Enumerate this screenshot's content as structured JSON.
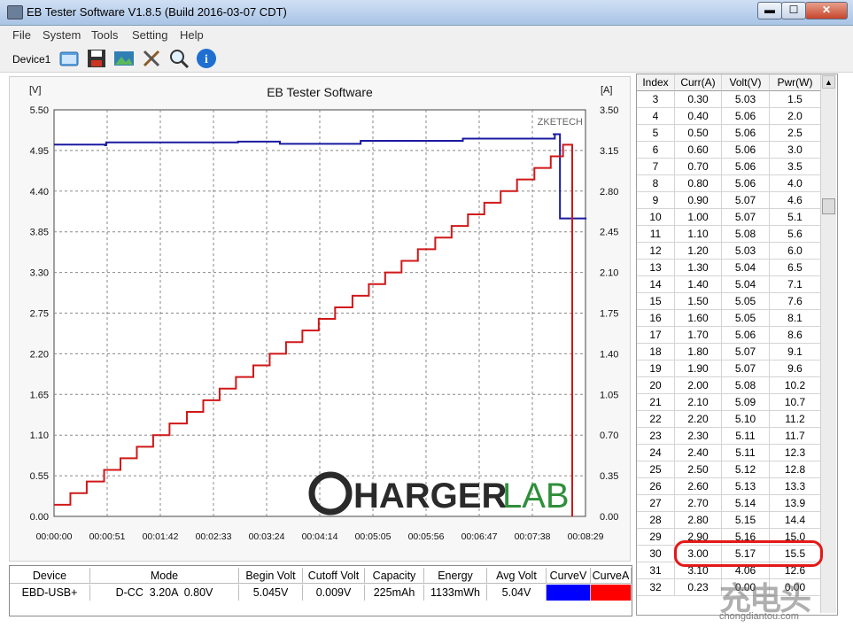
{
  "window": {
    "title": "EB Tester Software V1.8.5 (Build 2016-03-07 CDT)",
    "minimize_glyph": "▬",
    "maximize_glyph": "☐",
    "close_glyph": "✕"
  },
  "menu": [
    "File",
    "System",
    "Tools",
    "Setting",
    "Help"
  ],
  "toolbar": {
    "device": "Device1",
    "icons": [
      "folder-open-icon",
      "save-icon",
      "picture-icon",
      "tools-icon",
      "magnifier-icon",
      "info-icon"
    ]
  },
  "chart_data": {
    "type": "line",
    "title": "EB Tester Software",
    "watermark": "ZKETECH",
    "y_left_unit": "[V]",
    "y_right_unit": "[A]",
    "y_left_ticks": [
      "5.50",
      "4.95",
      "4.40",
      "3.85",
      "3.30",
      "2.75",
      "2.20",
      "1.65",
      "1.10",
      "0.55",
      "0.00"
    ],
    "y_right_ticks": [
      "3.50",
      "3.15",
      "2.80",
      "2.45",
      "2.10",
      "1.75",
      "1.40",
      "1.05",
      "0.70",
      "0.35",
      "0.00"
    ],
    "x_ticks": [
      "00:00:00",
      "00:00:51",
      "00:01:42",
      "00:02:33",
      "00:03:24",
      "00:04:14",
      "00:05:05",
      "00:05:56",
      "00:06:47",
      "00:07:38",
      "00:08:29"
    ],
    "ylim_left": [
      0,
      5.5
    ],
    "ylim_right": [
      0,
      3.5
    ],
    "grid": true,
    "series": [
      {
        "color": "#1a1aa0",
        "axis": "left",
        "x": [
          0,
          50,
          51,
          120,
          180,
          220,
          221,
          300,
          400,
          490,
          488,
          495,
          515,
          516,
          517,
          520,
          521
        ],
        "y": [
          5.03,
          5.02,
          5.06,
          5.06,
          5.07,
          5.07,
          5.04,
          5.08,
          5.11,
          5.17,
          5.17,
          4.03,
          4.03,
          4.03,
          4.03,
          4.03,
          4.03
        ]
      },
      {
        "color": "#d01818",
        "axis": "right",
        "x": [
          0,
          16,
          32,
          49,
          65,
          81,
          97,
          113,
          130,
          146,
          162,
          178,
          195,
          211,
          227,
          243,
          259,
          275,
          292,
          308,
          324,
          340,
          356,
          373,
          389,
          405,
          421,
          437,
          453,
          470,
          486,
          498,
          507
        ],
        "y": [
          0.1,
          0.2,
          0.3,
          0.4,
          0.5,
          0.6,
          0.7,
          0.8,
          0.9,
          1.0,
          1.1,
          1.2,
          1.3,
          1.4,
          1.5,
          1.6,
          1.7,
          1.8,
          1.9,
          2.0,
          2.1,
          2.2,
          2.3,
          2.4,
          2.5,
          2.6,
          2.7,
          2.8,
          2.9,
          3.0,
          3.1,
          3.2,
          0.0
        ]
      }
    ]
  },
  "logo": {
    "main": "HARGER",
    "accent": "LAB"
  },
  "table": {
    "columns": [
      "Index",
      "Curr(A)",
      "Volt(V)",
      "Pwr(W)"
    ],
    "rows": [
      [
        "3",
        "0.30",
        "5.03",
        "1.5"
      ],
      [
        "4",
        "0.40",
        "5.06",
        "2.0"
      ],
      [
        "5",
        "0.50",
        "5.06",
        "2.5"
      ],
      [
        "6",
        "0.60",
        "5.06",
        "3.0"
      ],
      [
        "7",
        "0.70",
        "5.06",
        "3.5"
      ],
      [
        "8",
        "0.80",
        "5.06",
        "4.0"
      ],
      [
        "9",
        "0.90",
        "5.07",
        "4.6"
      ],
      [
        "10",
        "1.00",
        "5.07",
        "5.1"
      ],
      [
        "11",
        "1.10",
        "5.08",
        "5.6"
      ],
      [
        "12",
        "1.20",
        "5.03",
        "6.0"
      ],
      [
        "13",
        "1.30",
        "5.04",
        "6.5"
      ],
      [
        "14",
        "1.40",
        "5.04",
        "7.1"
      ],
      [
        "15",
        "1.50",
        "5.05",
        "7.6"
      ],
      [
        "16",
        "1.60",
        "5.05",
        "8.1"
      ],
      [
        "17",
        "1.70",
        "5.06",
        "8.6"
      ],
      [
        "18",
        "1.80",
        "5.07",
        "9.1"
      ],
      [
        "19",
        "1.90",
        "5.07",
        "9.6"
      ],
      [
        "20",
        "2.00",
        "5.08",
        "10.2"
      ],
      [
        "21",
        "2.10",
        "5.09",
        "10.7"
      ],
      [
        "22",
        "2.20",
        "5.10",
        "11.2"
      ],
      [
        "23",
        "2.30",
        "5.11",
        "11.7"
      ],
      [
        "24",
        "2.40",
        "5.11",
        "12.3"
      ],
      [
        "25",
        "2.50",
        "5.12",
        "12.8"
      ],
      [
        "26",
        "2.60",
        "5.13",
        "13.3"
      ],
      [
        "27",
        "2.70",
        "5.14",
        "13.9"
      ],
      [
        "28",
        "2.80",
        "5.15",
        "14.4"
      ],
      [
        "29",
        "2.90",
        "5.16",
        "15.0"
      ],
      [
        "30",
        "3.00",
        "5.17",
        "15.5"
      ],
      [
        "31",
        "3.10",
        "4.06",
        "12.6"
      ],
      [
        "32",
        "0.23",
        "0.00",
        "0.00"
      ]
    ]
  },
  "summary": {
    "headers": [
      "Device",
      "Mode",
      "Begin Volt",
      "Cutoff Volt",
      "Capacity",
      "Energy",
      "Avg Volt",
      "CurveV",
      "CurveA"
    ],
    "values": [
      "EBD-USB+",
      "D-CC  3.20A  0.80V",
      "5.045V",
      "0.009V",
      "225mAh",
      "1133mWh",
      "5.04V"
    ],
    "curve_v_color": "#0000ff",
    "curve_a_color": "#ff0000"
  },
  "watermark_site": "chongdiantou.com"
}
